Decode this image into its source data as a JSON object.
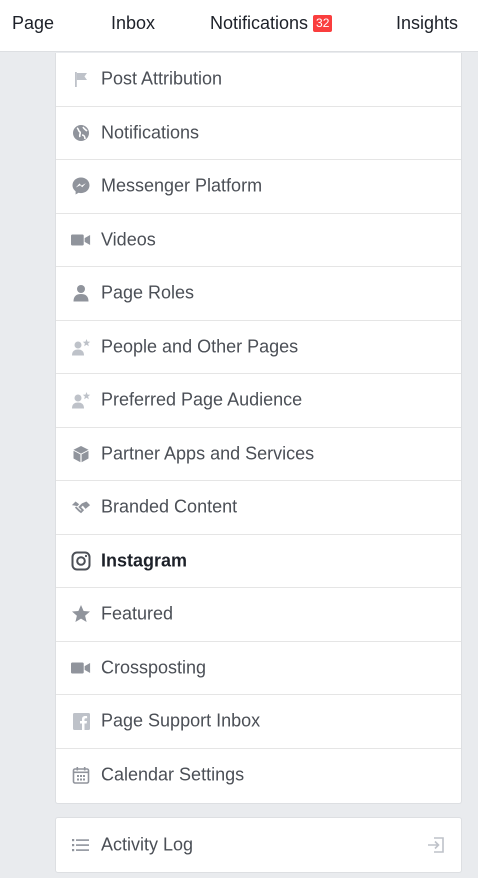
{
  "topnav": {
    "tabs": [
      {
        "label": "Page"
      },
      {
        "label": "Inbox"
      },
      {
        "label": "Notifications",
        "badge": "32"
      },
      {
        "label": "Insights"
      }
    ]
  },
  "settings_menu": {
    "items": [
      {
        "label": "Post Attribution",
        "icon": "flag-icon"
      },
      {
        "label": "Notifications",
        "icon": "globe-icon"
      },
      {
        "label": "Messenger Platform",
        "icon": "messenger-icon"
      },
      {
        "label": "Videos",
        "icon": "video-camera-icon"
      },
      {
        "label": "Page Roles",
        "icon": "person-icon"
      },
      {
        "label": "People and Other Pages",
        "icon": "person-star-icon"
      },
      {
        "label": "Preferred Page Audience",
        "icon": "person-star-icon"
      },
      {
        "label": "Partner Apps and Services",
        "icon": "cube-icon"
      },
      {
        "label": "Branded Content",
        "icon": "handshake-icon"
      },
      {
        "label": "Instagram",
        "icon": "instagram-icon",
        "active": true
      },
      {
        "label": "Featured",
        "icon": "star-icon"
      },
      {
        "label": "Crossposting",
        "icon": "video-camera-icon"
      },
      {
        "label": "Page Support Inbox",
        "icon": "facebook-icon"
      },
      {
        "label": "Calendar Settings",
        "icon": "calendar-icon"
      }
    ]
  },
  "activity_log": {
    "label": "Activity Log",
    "icon": "list-icon",
    "action_icon": "exit-icon"
  },
  "colors": {
    "background": "#e9ebee",
    "badge": "#fa3e3e",
    "icon": "#90949c",
    "text": "#4b4f56",
    "active_text": "#1d2129"
  }
}
